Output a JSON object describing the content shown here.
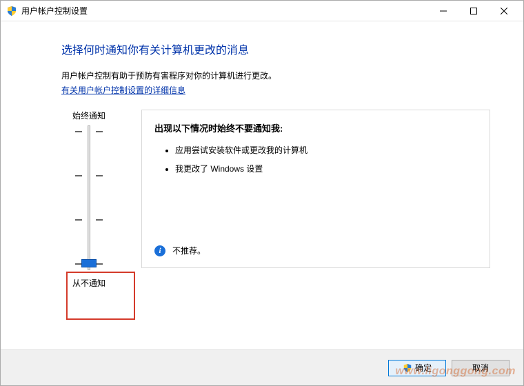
{
  "window": {
    "title": "用户帐户控制设置"
  },
  "heading": "选择何时通知你有关计算机更改的消息",
  "subtext": "用户帐户控制有助于预防有害程序对你的计算机进行更改。",
  "help_link": "有关用户帐户控制设置的详细信息",
  "slider": {
    "top_label": "始终通知",
    "bottom_label": "从不通知",
    "level_count": 4,
    "selected_level": 0
  },
  "panel": {
    "title": "出现以下情况时始终不要通知我:",
    "items": [
      "应用尝试安装软件或更改我的计算机",
      "我更改了 Windows 设置"
    ],
    "note": "不推荐。"
  },
  "buttons": {
    "ok": "确定",
    "cancel": "取消"
  },
  "watermark": "www.ligonggong.com",
  "icons": {
    "shield": "shield-icon",
    "info": "info-icon",
    "minimize": "minimize-icon",
    "maximize": "maximize-icon",
    "close": "close-icon"
  }
}
